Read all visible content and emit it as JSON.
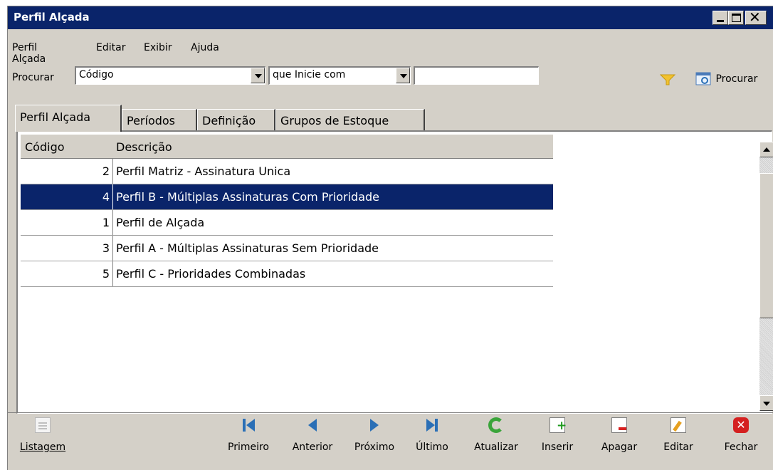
{
  "window": {
    "title": "Perfil Alçada"
  },
  "menu": [
    {
      "label": "Perfil Alçada"
    },
    {
      "label": "Editar"
    },
    {
      "label": "Exibir"
    },
    {
      "label": "Ajuda"
    }
  ],
  "search": {
    "label": "Procurar",
    "field_value": "Código",
    "operator_value": "que Inicie com",
    "text_value": "",
    "button_label": "Procurar"
  },
  "tabs": [
    {
      "label": "Perfil Alçada",
      "active": true
    },
    {
      "label": "Períodos"
    },
    {
      "label": "Definição"
    },
    {
      "label": "Grupos de Estoque"
    }
  ],
  "grid": {
    "columns": [
      "Código",
      "Descrição"
    ],
    "rows": [
      {
        "code": "2",
        "description": "Perfil Matriz - Assinatura Unica"
      },
      {
        "code": "4",
        "description": "Perfil B - Múltiplas Assinaturas Com Prioridade",
        "selected": true
      },
      {
        "code": "1",
        "description": "Perfil de Alçada"
      },
      {
        "code": "3",
        "description": "Perfil A - Múltiplas Assinaturas Sem Prioridade"
      },
      {
        "code": "5",
        "description": "Perfil C - Prioridades Combinadas"
      }
    ]
  },
  "toolbar": {
    "listagem": "Listagem",
    "primeiro": "Primeiro",
    "anterior": "Anterior",
    "proximo": "Próximo",
    "ultimo": "Último",
    "atualizar": "Atualizar",
    "inserir": "Inserir",
    "apagar": "Apagar",
    "editar": "Editar",
    "fechar": "Fechar"
  },
  "colors": {
    "titlebar": "#0a246a",
    "selection": "#0a246a",
    "face": "#d4d0c8"
  }
}
